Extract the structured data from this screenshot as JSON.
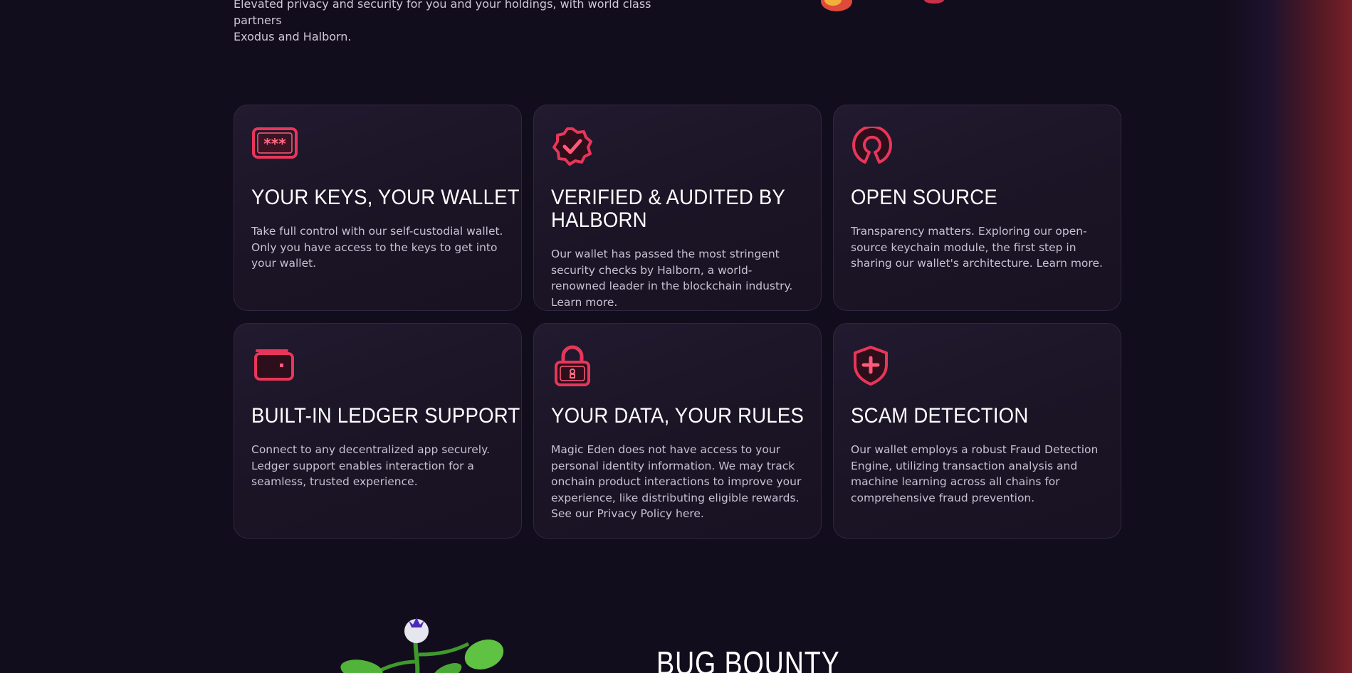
{
  "intro": {
    "line1": "Elevated privacy and security for you and your holdings, with world class partners",
    "line2": "Exodus and Halborn."
  },
  "cards": [
    {
      "icon": "password-card-icon",
      "title": "YOUR KEYS, YOUR WALLET",
      "text": "Take full control with our self-custodial wallet. Only you have access to the keys to get into your wallet."
    },
    {
      "icon": "verified-badge-icon",
      "title": "VERIFIED & AUDITED BY HALBORN",
      "text": "Our wallet has passed the most stringent security checks by Halborn, a world-renowned leader in the blockchain industry. Learn more."
    },
    {
      "icon": "open-source-icon",
      "title": "OPEN SOURCE",
      "text": "Transparency matters. Exploring our open-source keychain module, the first step in sharing our wallet's architecture. Learn more."
    },
    {
      "icon": "wallet-icon",
      "title": "BUILT-IN LEDGER SUPPORT",
      "text": "Connect to any decentralized app securely. Ledger support enables interaction for a seamless, trusted experience."
    },
    {
      "icon": "padlock-icon",
      "title": "YOUR DATA, YOUR RULES",
      "text": "Magic Eden does not have access to your personal identity information. We may track onchain product interactions to improve your experience, like distributing eligible rewards. See our Privacy Policy here."
    },
    {
      "icon": "shield-plus-icon",
      "title": "SCAM DETECTION",
      "text": "Our wallet employs a robust Fraud Detection Engine, utilizing transaction analysis and machine learning across all chains for comprehensive fraud prevention."
    }
  ],
  "next_section": {
    "title": "BUG BOUNTY"
  },
  "colors": {
    "accent": "#e8365a",
    "background": "#120d1c",
    "card": "#1c1528"
  }
}
